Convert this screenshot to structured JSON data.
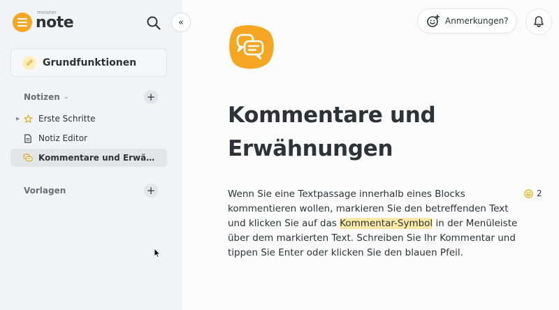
{
  "app": {
    "logo_small": "meister",
    "logo_main": "note",
    "collapse_glyph": "«",
    "accent_color": "#f5a623"
  },
  "sidebar": {
    "project_title": "Grundfunktionen",
    "notes_section": {
      "label": "Notizen",
      "add_glyph": "+"
    },
    "items": [
      {
        "label": "Erste Schritte",
        "icon": "star-icon",
        "has_children": true,
        "active": false
      },
      {
        "label": "Notiz Editor",
        "icon": "document-icon",
        "has_children": false,
        "active": false
      },
      {
        "label": "Kommentare und Erwähnungen",
        "icon": "comment-icon",
        "has_children": false,
        "active": true
      }
    ],
    "templates_section": {
      "label": "Vorlagen",
      "add_glyph": "+"
    }
  },
  "header": {
    "annotations_label": "Anmerkungen?"
  },
  "note": {
    "title_line1": "Kommentare und",
    "title_line2": "Erwähnungen",
    "body_before": "Wenn Sie eine Textpassage innerhalb eines Blocks kommentieren wollen, markieren Sie den betreffenden Text und klicken Sie auf das ",
    "body_highlight": "Kommentar-Symbol",
    "body_after": " in der Menüleiste über dem markierten Text. Schreiben Sie Ihr Kommentar und tippen Sie Enter oder klicken Sie den blauen Pfeil.",
    "comment_count": "2"
  }
}
